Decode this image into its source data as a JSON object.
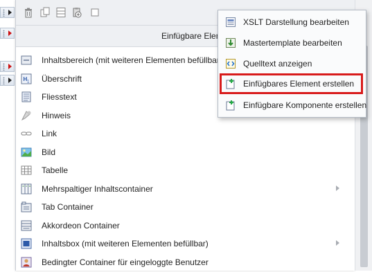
{
  "header": {
    "title": "Einfügbare Elemente"
  },
  "items": [
    {
      "label": "Inhaltsbereich (mit weiteren Elementen befüllbar)",
      "icon": "content-area-icon",
      "submenu": false
    },
    {
      "label": "Überschrift",
      "icon": "heading-icon",
      "submenu": false
    },
    {
      "label": "Fliesstext",
      "icon": "text-icon",
      "submenu": false
    },
    {
      "label": "Hinweis",
      "icon": "hint-icon",
      "submenu": false
    },
    {
      "label": "Link",
      "icon": "link-icon",
      "submenu": false
    },
    {
      "label": "Bild",
      "icon": "image-icon",
      "submenu": false
    },
    {
      "label": "Tabelle",
      "icon": "table-icon",
      "submenu": false
    },
    {
      "label": "Mehrspaltiger Inhaltscontainer",
      "icon": "columns-icon",
      "submenu": true
    },
    {
      "label": "Tab Container",
      "icon": "tab-container-icon",
      "submenu": false
    },
    {
      "label": "Akkordeon Container",
      "icon": "accordion-icon",
      "submenu": false
    },
    {
      "label": "Inhaltsbox (mit weiteren Elementen befüllbar)",
      "icon": "content-box-icon",
      "submenu": true
    },
    {
      "label": "Bedingter Container für eingeloggte Benutzer",
      "icon": "user-container-icon",
      "submenu": false
    }
  ],
  "context_menu": {
    "items": [
      {
        "label": "XSLT Darstellung bearbeiten",
        "icon": "xslt-icon"
      },
      {
        "label": "Mastertemplate bearbeiten",
        "icon": "mastertemplate-icon"
      },
      {
        "label": "Quelltext anzeigen",
        "icon": "source-code-icon"
      },
      {
        "label": "Einfügbares Element erstellen",
        "icon": "create-element-icon",
        "highlighted": true
      },
      {
        "label": "Einfügbare Komponente erstellen",
        "icon": "create-component-icon"
      }
    ]
  },
  "colors": {
    "highlight_border": "#d81b1b",
    "panel_bg": "#eef0f3"
  }
}
